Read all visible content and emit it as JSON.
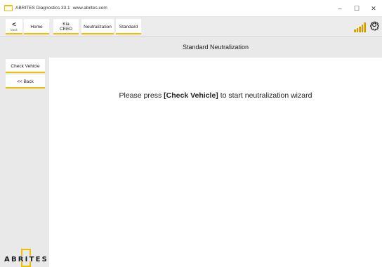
{
  "window": {
    "title": "ABRITES Diagnostics 33.1",
    "url": "www.abrites.com",
    "minimize": "–",
    "maximize": "☐",
    "close": "✕"
  },
  "toolbar": {
    "back_arrow": "<",
    "back_label": "back",
    "home_label": "Home",
    "vehicle_make": "Kia",
    "vehicle_model": "CEED",
    "neutralization_label": "Neutralization",
    "standard_label": "Standard"
  },
  "header": {
    "title": "Standard Neutralization"
  },
  "sidebar": {
    "check_vehicle_label": "Check Vehicle",
    "back_label": "<< Back",
    "logo_text": "ABRITES"
  },
  "main": {
    "message_prefix": "Please press ",
    "message_bold": "[Check Vehicle]",
    "message_suffix": " to start neutralization wizard"
  },
  "colors": {
    "accent": "#f0c000",
    "panel": "#e9e9e9"
  },
  "icons": [
    "app-icon",
    "back-chevron-icon",
    "signal-strength-icon",
    "gear-icon"
  ]
}
